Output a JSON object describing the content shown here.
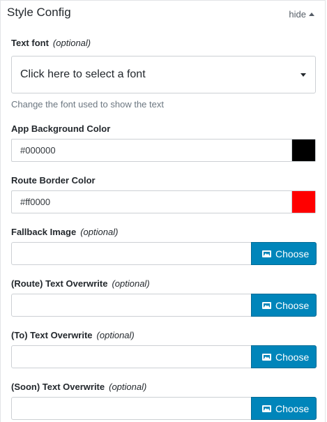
{
  "panel": {
    "title": "Style Config",
    "toggle_label": "hide"
  },
  "optional_label": "(optional)",
  "text_font": {
    "label": "Text font",
    "selected": "Click here to select a font",
    "help": "Change the font used to show the text"
  },
  "app_bg": {
    "label": "App Background Color",
    "value": "#000000",
    "swatch": "#000000"
  },
  "route_border": {
    "label": "Route Border Color",
    "value": "#ff0000",
    "swatch": "#ff0000"
  },
  "fallback_image": {
    "label": "Fallback Image",
    "value": "",
    "button": "Choose"
  },
  "route_text": {
    "label": "(Route) Text Overwrite",
    "value": "",
    "button": "Choose"
  },
  "to_text": {
    "label": "(To) Text Overwrite",
    "value": "",
    "button": "Choose"
  },
  "soon_text": {
    "label": "(Soon) Text Overwrite",
    "value": "",
    "button": "Choose"
  },
  "colors": {
    "accent": "#0085ba",
    "border": "#ccd0d4"
  }
}
